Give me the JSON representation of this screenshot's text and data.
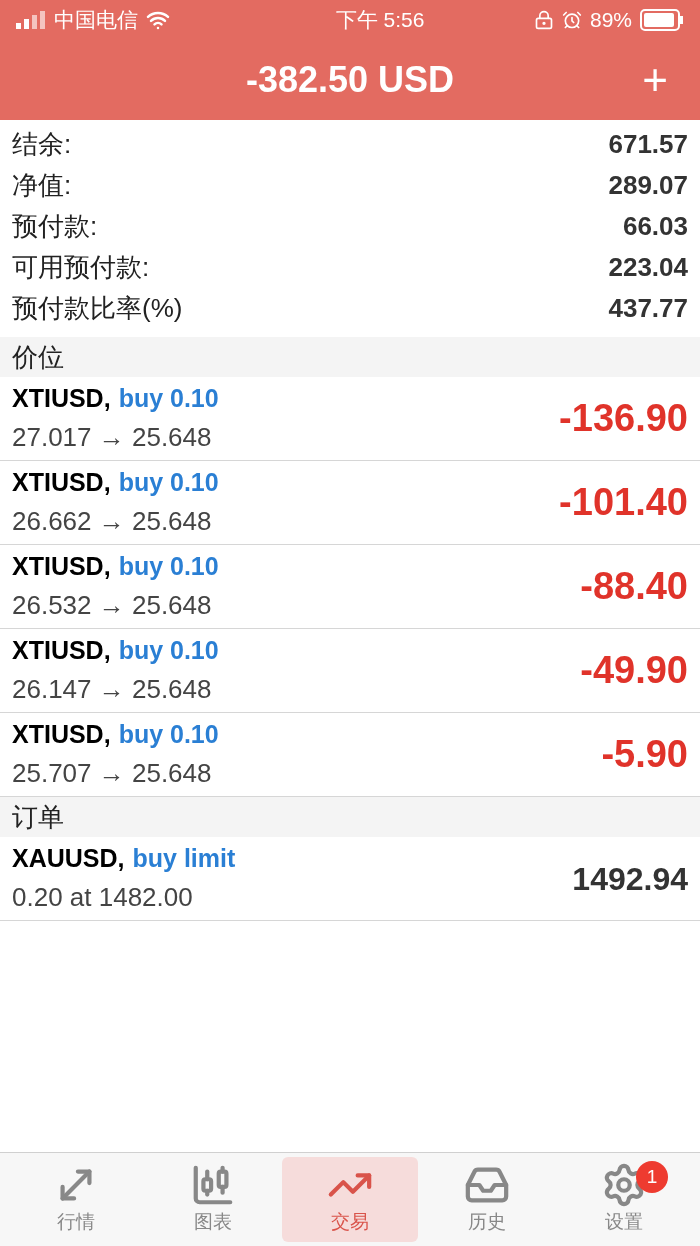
{
  "status_bar": {
    "carrier": "中国电信",
    "time": "下午 5:56",
    "battery": "89%"
  },
  "header": {
    "title": "-382.50 USD",
    "action": "+"
  },
  "summary": [
    {
      "label": "结余:",
      "value": "671.57"
    },
    {
      "label": "净值:",
      "value": "289.07"
    },
    {
      "label": "预付款:",
      "value": "66.03"
    },
    {
      "label": "可用预付款:",
      "value": "223.04"
    },
    {
      "label": "预付款比率(%)",
      "value": "437.77"
    }
  ],
  "positions_section": {
    "title": "价位"
  },
  "positions": [
    {
      "symbol": "XTIUSD,",
      "side": "buy 0.10",
      "prices": "27.017 → 25.648",
      "profit": "-136.90"
    },
    {
      "symbol": "XTIUSD,",
      "side": "buy 0.10",
      "prices": "26.662 → 25.648",
      "profit": "-101.40"
    },
    {
      "symbol": "XTIUSD,",
      "side": "buy 0.10",
      "prices": "26.532 → 25.648",
      "profit": "-88.40"
    },
    {
      "symbol": "XTIUSD,",
      "side": "buy 0.10",
      "prices": "26.147 → 25.648",
      "profit": "-49.90"
    },
    {
      "symbol": "XTIUSD,",
      "side": "buy 0.10",
      "prices": "25.707 → 25.648",
      "profit": "-5.90"
    }
  ],
  "orders_section": {
    "title": "订单"
  },
  "orders": [
    {
      "symbol": "XAUUSD,",
      "side": "buy limit",
      "detail": "0.20 at 1482.00",
      "price": "1492.94"
    }
  ],
  "tab_bar": [
    {
      "kind": "quotes",
      "label": "行情",
      "selected": false
    },
    {
      "kind": "chart",
      "label": "图表",
      "selected": false
    },
    {
      "kind": "trade",
      "label": "交易",
      "selected": true
    },
    {
      "kind": "history",
      "label": "历史",
      "selected": false
    },
    {
      "kind": "settings",
      "label": "设置",
      "selected": false,
      "badge": "1"
    }
  ]
}
